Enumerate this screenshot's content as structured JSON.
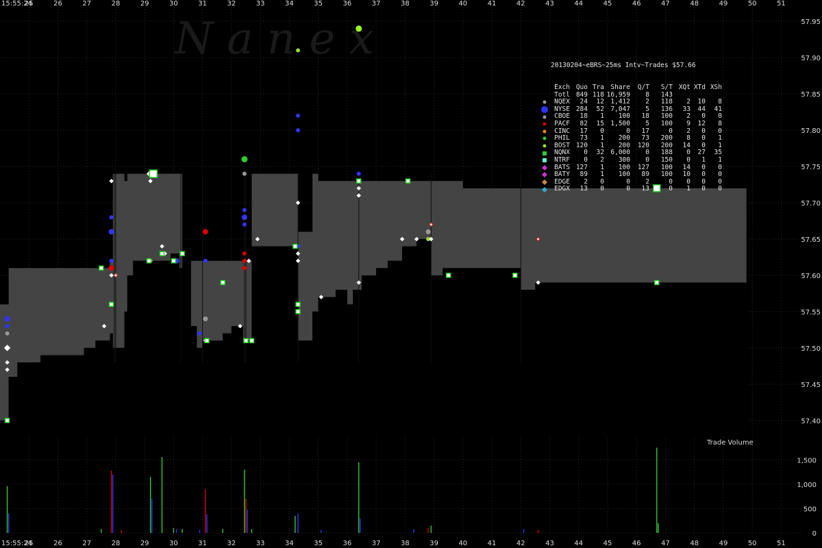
{
  "watermark": "N a n e x",
  "chart_data": {
    "type": "line",
    "title": "20130204~eBRS~25ms Intv~Trades $57.66",
    "x_start_label": "15:55:24",
    "x_ticks": [
      "25",
      "26",
      "27",
      "28",
      "29",
      "30",
      "31",
      "32",
      "33",
      "34",
      "35",
      "36",
      "37",
      "38",
      "39",
      "40",
      "41",
      "42",
      "43",
      "44",
      "45",
      "46",
      "47",
      "48",
      "49",
      "50",
      "51"
    ],
    "xlim": [
      24,
      51.7
    ],
    "ylim": [
      57.38,
      57.97
    ],
    "y_ticks": [
      "57.40",
      "57.45",
      "57.50",
      "57.55",
      "57.60",
      "57.65",
      "57.70",
      "57.75",
      "57.80",
      "57.85",
      "57.90",
      "57.95"
    ],
    "volume_label": "Trade Volume",
    "volume_ylim": [
      0,
      1800
    ],
    "volume_ticks": [
      "0",
      "500",
      "1,000",
      "1,500"
    ],
    "nbbo": [
      [
        24.0,
        57.4,
        57.56
      ],
      [
        24.25,
        57.4,
        57.56
      ],
      [
        24.3,
        57.46,
        57.61
      ],
      [
        24.6,
        57.48,
        57.61
      ],
      [
        25.0,
        57.48,
        57.61
      ],
      [
        25.4,
        57.49,
        57.61
      ],
      [
        26.0,
        57.49,
        57.61
      ],
      [
        26.9,
        57.5,
        57.61
      ],
      [
        27.3,
        57.51,
        57.61
      ],
      [
        27.8,
        57.52,
        57.62
      ],
      [
        27.9,
        57.5,
        57.74
      ],
      [
        28.3,
        57.55,
        57.73
      ],
      [
        28.4,
        57.6,
        57.74
      ],
      [
        28.6,
        57.62,
        57.74
      ],
      [
        29.5,
        57.62,
        57.74
      ],
      [
        29.9,
        57.63,
        57.74
      ],
      [
        30.2,
        57.61,
        57.74
      ],
      [
        30.3,
        57.62,
        57.62
      ],
      [
        30.6,
        57.53,
        57.62
      ],
      [
        30.8,
        57.5,
        57.62
      ],
      [
        31.0,
        57.51,
        57.62
      ],
      [
        31.4,
        57.51,
        57.62
      ],
      [
        31.7,
        57.52,
        57.62
      ],
      [
        32.0,
        57.53,
        57.62
      ],
      [
        32.4,
        57.51,
        57.62
      ],
      [
        32.7,
        57.64,
        57.74
      ],
      [
        34.2,
        57.64,
        57.74
      ],
      [
        34.3,
        57.51,
        57.66
      ],
      [
        34.8,
        57.55,
        57.74
      ],
      [
        35.0,
        57.57,
        57.73
      ],
      [
        35.6,
        57.58,
        57.73
      ],
      [
        36.0,
        57.56,
        57.73
      ],
      [
        36.2,
        57.58,
        57.73
      ],
      [
        36.5,
        57.6,
        57.73
      ],
      [
        37.0,
        57.61,
        57.73
      ],
      [
        37.4,
        57.62,
        57.73
      ],
      [
        37.9,
        57.64,
        57.73
      ],
      [
        38.4,
        57.65,
        57.73
      ],
      [
        38.9,
        57.6,
        57.73
      ],
      [
        39.0,
        57.6,
        57.73
      ],
      [
        39.3,
        57.61,
        57.73
      ],
      [
        39.6,
        57.61,
        57.73
      ],
      [
        40.0,
        57.61,
        57.72
      ],
      [
        42.0,
        57.58,
        57.72
      ],
      [
        42.5,
        57.59,
        57.72
      ],
      [
        43.0,
        57.59,
        57.72
      ],
      [
        44.0,
        57.59,
        57.72
      ],
      [
        46.0,
        57.59,
        57.72
      ],
      [
        48.0,
        57.59,
        57.72
      ],
      [
        49.0,
        57.59,
        57.72
      ],
      [
        49.8,
        57.59,
        57.72
      ],
      [
        49.8,
        57.59,
        57.59
      ]
    ],
    "quotes": [
      {
        "t": 24.25,
        "p": 57.54,
        "c": "#3333ff",
        "s": 4
      },
      {
        "t": 24.25,
        "p": 57.53,
        "c": "#3333ff",
        "s": 3
      },
      {
        "t": 24.25,
        "p": 57.52,
        "c": "#999999",
        "s": 3
      },
      {
        "t": 24.25,
        "p": 57.5,
        "c": "#ffffff",
        "s": 4
      },
      {
        "t": 24.25,
        "p": 57.48,
        "c": "#ffffff",
        "s": 2.5
      },
      {
        "t": 24.25,
        "p": 57.47,
        "c": "#ffffff",
        "s": 2.5
      },
      {
        "t": 27.6,
        "p": 57.53,
        "c": "#ffffff",
        "s": 2.5
      },
      {
        "t": 27.85,
        "p": 57.73,
        "c": "#ffffff",
        "s": 2.5
      },
      {
        "t": 27.85,
        "p": 57.68,
        "c": "#3333ff",
        "s": 3
      },
      {
        "t": 27.85,
        "p": 57.66,
        "c": "#3333ff",
        "s": 4
      },
      {
        "t": 27.85,
        "p": 57.62,
        "c": "#3333ff",
        "s": 3
      },
      {
        "t": 27.85,
        "p": 57.61,
        "c": "#dd0000",
        "s": 4
      },
      {
        "t": 27.85,
        "p": 57.6,
        "c": "#ffffff",
        "s": 2.5
      },
      {
        "t": 28.0,
        "p": 57.6,
        "c": "#ffffff",
        "s": 2.5
      },
      {
        "t": 29.2,
        "p": 57.74,
        "c": "#ffffff",
        "s": 5
      },
      {
        "t": 29.2,
        "p": 57.73,
        "c": "#ffffff",
        "s": 2.5
      },
      {
        "t": 29.2,
        "p": 57.62,
        "c": "#ffffff",
        "s": 2.5
      },
      {
        "t": 29.6,
        "p": 57.64,
        "c": "#ffffff",
        "s": 2.5
      },
      {
        "t": 29.7,
        "p": 57.63,
        "c": "#ffffff",
        "s": 2.5
      },
      {
        "t": 30.1,
        "p": 57.62,
        "c": "#3333ff",
        "s": 4
      },
      {
        "t": 30.9,
        "p": 57.52,
        "c": "#3333ff",
        "s": 3
      },
      {
        "t": 31.1,
        "p": 57.66,
        "c": "#dd0000",
        "s": 4
      },
      {
        "t": 31.1,
        "p": 57.62,
        "c": "#3333ff",
        "s": 3
      },
      {
        "t": 31.1,
        "p": 57.54,
        "c": "#999999",
        "s": 3.5
      },
      {
        "t": 31.1,
        "p": 57.51,
        "c": "#ffffff",
        "s": 2.5
      },
      {
        "t": 32.3,
        "p": 57.53,
        "c": "#ffffff",
        "s": 2.5
      },
      {
        "t": 32.45,
        "p": 57.76,
        "c": "#33cc33",
        "s": 4.5
      },
      {
        "t": 32.45,
        "p": 57.74,
        "c": "#999999",
        "s": 3
      },
      {
        "t": 32.45,
        "p": 57.69,
        "c": "#3333ff",
        "s": 3
      },
      {
        "t": 32.45,
        "p": 57.68,
        "c": "#3333ff",
        "s": 4
      },
      {
        "t": 32.45,
        "p": 57.67,
        "c": "#3333ff",
        "s": 3
      },
      {
        "t": 32.45,
        "p": 57.63,
        "c": "#dd0000",
        "s": 3
      },
      {
        "t": 32.45,
        "p": 57.62,
        "c": "#dd0000",
        "s": 3
      },
      {
        "t": 32.45,
        "p": 57.61,
        "c": "#dd0000",
        "s": 3
      },
      {
        "t": 32.6,
        "p": 57.62,
        "c": "#ffffff",
        "s": 2.5
      },
      {
        "t": 32.9,
        "p": 57.65,
        "c": "#ffffff",
        "s": 2.5
      },
      {
        "t": 34.3,
        "p": 57.91,
        "c": "#99dd22",
        "s": 3
      },
      {
        "t": 34.3,
        "p": 57.82,
        "c": "#3333ff",
        "s": 3
      },
      {
        "t": 34.3,
        "p": 57.8,
        "c": "#3333ff",
        "s": 3
      },
      {
        "t": 34.3,
        "p": 57.7,
        "c": "#ffffff",
        "s": 2.5
      },
      {
        "t": 34.3,
        "p": 57.64,
        "c": "#3333ff",
        "s": 3
      },
      {
        "t": 34.3,
        "p": 57.63,
        "c": "#ffffff",
        "s": 2.5
      },
      {
        "t": 34.3,
        "p": 57.62,
        "c": "#ffffff",
        "s": 2.5
      },
      {
        "t": 35.1,
        "p": 57.57,
        "c": "#ffffff",
        "s": 2.5
      },
      {
        "t": 36.4,
        "p": 57.94,
        "c": "#99ff22",
        "s": 4.5
      },
      {
        "t": 36.4,
        "p": 57.74,
        "c": "#3333ff",
        "s": 3
      },
      {
        "t": 36.4,
        "p": 57.72,
        "c": "#ffffff",
        "s": 2.5
      },
      {
        "t": 36.4,
        "p": 57.71,
        "c": "#ffffff",
        "s": 2.5
      },
      {
        "t": 36.4,
        "p": 57.59,
        "c": "#ffffff",
        "s": 2.5
      },
      {
        "t": 37.9,
        "p": 57.65,
        "c": "#ffffff",
        "s": 2.5
      },
      {
        "t": 38.4,
        "p": 57.65,
        "c": "#ffffff",
        "s": 2.5
      },
      {
        "t": 38.8,
        "p": 57.66,
        "c": "#999999",
        "s": 3.5
      },
      {
        "t": 38.8,
        "p": 57.65,
        "c": "#99dd22",
        "s": 3
      },
      {
        "t": 38.9,
        "p": 57.67,
        "c": "#ff6666",
        "s": 2.5
      },
      {
        "t": 38.9,
        "p": 57.65,
        "c": "#ffffff",
        "s": 2.5
      },
      {
        "t": 42.6,
        "p": 57.65,
        "c": "#ff6666",
        "s": 2.5
      },
      {
        "t": 42.6,
        "p": 57.59,
        "c": "#ffffff",
        "s": 2.5
      },
      {
        "t": 28.0,
        "p": 57.6,
        "c": "#ff6666",
        "s": 2.5
      }
    ],
    "trades": [
      {
        "t": 24.25,
        "p": 57.4,
        "s": 3
      },
      {
        "t": 27.5,
        "p": 57.61,
        "s": 3
      },
      {
        "t": 27.85,
        "p": 57.56,
        "s": 3
      },
      {
        "t": 29.3,
        "p": 57.74,
        "s": 5.5
      },
      {
        "t": 29.15,
        "p": 57.62,
        "s": 3
      },
      {
        "t": 29.6,
        "p": 57.63,
        "s": 3
      },
      {
        "t": 30.0,
        "p": 57.62,
        "s": 3
      },
      {
        "t": 30.3,
        "p": 57.63,
        "s": 3
      },
      {
        "t": 31.15,
        "p": 57.51,
        "s": 3
      },
      {
        "t": 31.7,
        "p": 57.59,
        "s": 3
      },
      {
        "t": 32.5,
        "p": 57.51,
        "s": 3
      },
      {
        "t": 32.7,
        "p": 57.51,
        "s": 3
      },
      {
        "t": 34.2,
        "p": 57.64,
        "s": 3
      },
      {
        "t": 34.3,
        "p": 57.56,
        "s": 3
      },
      {
        "t": 34.3,
        "p": 57.55,
        "s": 3
      },
      {
        "t": 36.4,
        "p": 57.73,
        "s": 3
      },
      {
        "t": 38.1,
        "p": 57.73,
        "s": 3
      },
      {
        "t": 39.5,
        "p": 57.6,
        "s": 3
      },
      {
        "t": 41.8,
        "p": 57.6,
        "s": 3
      },
      {
        "t": 46.7,
        "p": 57.72,
        "s": 5
      },
      {
        "t": 46.7,
        "p": 57.59,
        "s": 3
      }
    ],
    "volume": [
      {
        "t": 24.25,
        "v": 960,
        "c": "#33cc33"
      },
      {
        "t": 24.3,
        "v": 400,
        "c": "#3333ff"
      },
      {
        "t": 27.5,
        "v": 80,
        "c": "#33cc33"
      },
      {
        "t": 27.85,
        "v": 1280,
        "c": "#dd0000"
      },
      {
        "t": 27.9,
        "v": 1200,
        "c": "#3333ff"
      },
      {
        "t": 28.2,
        "v": 60,
        "c": "#dd0000"
      },
      {
        "t": 29.2,
        "v": 1150,
        "c": "#33cc33"
      },
      {
        "t": 29.25,
        "v": 700,
        "c": "#3333ff"
      },
      {
        "t": 29.6,
        "v": 1560,
        "c": "#33cc33"
      },
      {
        "t": 30.0,
        "v": 100,
        "c": "#33cc33"
      },
      {
        "t": 30.1,
        "v": 80,
        "c": "#3333ff"
      },
      {
        "t": 30.3,
        "v": 80,
        "c": "#33cc33"
      },
      {
        "t": 30.9,
        "v": 60,
        "c": "#3333ff"
      },
      {
        "t": 31.1,
        "v": 900,
        "c": "#dd0000"
      },
      {
        "t": 31.15,
        "v": 380,
        "c": "#3333ff"
      },
      {
        "t": 31.7,
        "v": 80,
        "c": "#33cc33"
      },
      {
        "t": 32.45,
        "v": 1300,
        "c": "#33cc33"
      },
      {
        "t": 32.5,
        "v": 700,
        "c": "#dd0000"
      },
      {
        "t": 32.55,
        "v": 480,
        "c": "#3333ff"
      },
      {
        "t": 32.7,
        "v": 80,
        "c": "#33cc33"
      },
      {
        "t": 34.2,
        "v": 350,
        "c": "#33cc33"
      },
      {
        "t": 34.3,
        "v": 400,
        "c": "#3333ff"
      },
      {
        "t": 35.1,
        "v": 60,
        "c": "#3333ff"
      },
      {
        "t": 36.4,
        "v": 1450,
        "c": "#33cc33"
      },
      {
        "t": 36.45,
        "v": 300,
        "c": "#3333ff"
      },
      {
        "t": 38.8,
        "v": 100,
        "c": "#dd0000"
      },
      {
        "t": 38.9,
        "v": 150,
        "c": "#33cc33"
      },
      {
        "t": 38.3,
        "v": 80,
        "c": "#3333ff"
      },
      {
        "t": 42.6,
        "v": 60,
        "c": "#dd0000"
      },
      {
        "t": 42.1,
        "v": 80,
        "c": "#3333ff"
      },
      {
        "t": 46.7,
        "v": 1750,
        "c": "#33cc33"
      },
      {
        "t": 46.75,
        "v": 200,
        "c": "#33cc33"
      }
    ],
    "legend": {
      "title": "20130204~eBRS~25ms Intv~Trades $57.66",
      "headers": [
        "Exch",
        "Quo",
        "Tra",
        "Share",
        "Q/T",
        "S/T",
        "XQt",
        "XTd",
        "XSh"
      ],
      "rows": [
        {
          "name": "Totl",
          "vals": [
            "849",
            "118",
            "16,959",
            "8",
            "143",
            "",
            "",
            ""
          ],
          "c": "",
          "shape": "none"
        },
        {
          "name": "NQEX",
          "vals": [
            "24",
            "12",
            "1,412",
            "2",
            "118",
            "2",
            "10",
            "8"
          ],
          "c": "#999999",
          "shape": "circle"
        },
        {
          "name": "NYSE",
          "vals": [
            "284",
            "52",
            "7,047",
            "5",
            "136",
            "33",
            "44",
            "41"
          ],
          "c": "#3333ff",
          "shape": "bigcircle"
        },
        {
          "name": "CBOE",
          "vals": [
            "18",
            "1",
            "100",
            "18",
            "100",
            "2",
            "0",
            "0"
          ],
          "c": "#999999",
          "shape": "circle"
        },
        {
          "name": "PACF",
          "vals": [
            "82",
            "15",
            "1,500",
            "5",
            "100",
            "9",
            "12",
            "8"
          ],
          "c": "#dd0000",
          "shape": "circle"
        },
        {
          "name": "CINC",
          "vals": [
            "17",
            "0",
            "0",
            "17",
            "0",
            "2",
            "0",
            "0"
          ],
          "c": "#ff8800",
          "shape": "circle"
        },
        {
          "name": "PHIL",
          "vals": [
            "73",
            "1",
            "200",
            "73",
            "200",
            "8",
            "0",
            "1"
          ],
          "c": "#33cc33",
          "shape": "circle"
        },
        {
          "name": "BOST",
          "vals": [
            "120",
            "1",
            "200",
            "120",
            "200",
            "14",
            "0",
            "1"
          ],
          "c": "#99dd22",
          "shape": "circle"
        },
        {
          "name": "NQNX",
          "vals": [
            "0",
            "32",
            "6,000",
            "0",
            "188",
            "0",
            "27",
            "35"
          ],
          "c": "#33cc33",
          "shape": "square"
        },
        {
          "name": "NTRF",
          "vals": [
            "0",
            "2",
            "300",
            "0",
            "150",
            "0",
            "1",
            "1"
          ],
          "c": "#66ffcc",
          "shape": "square"
        },
        {
          "name": "BATS",
          "vals": [
            "127",
            "1",
            "100",
            "127",
            "100",
            "14",
            "0",
            "0"
          ],
          "c": "#cc33cc",
          "shape": "diamond"
        },
        {
          "name": "BATY",
          "vals": [
            "89",
            "1",
            "100",
            "89",
            "100",
            "10",
            "0",
            "0"
          ],
          "c": "#cc33cc",
          "shape": "diamond"
        },
        {
          "name": "EDGE",
          "vals": [
            "2",
            "0",
            "0",
            "2",
            "0",
            "0",
            "0",
            "0"
          ],
          "c": "#cc8844",
          "shape": "diamond"
        },
        {
          "name": "EDGX",
          "vals": [
            "13",
            "0",
            "0",
            "13",
            "0",
            "1",
            "0",
            "0"
          ],
          "c": "#33aacc",
          "shape": "diamond"
        }
      ]
    }
  }
}
